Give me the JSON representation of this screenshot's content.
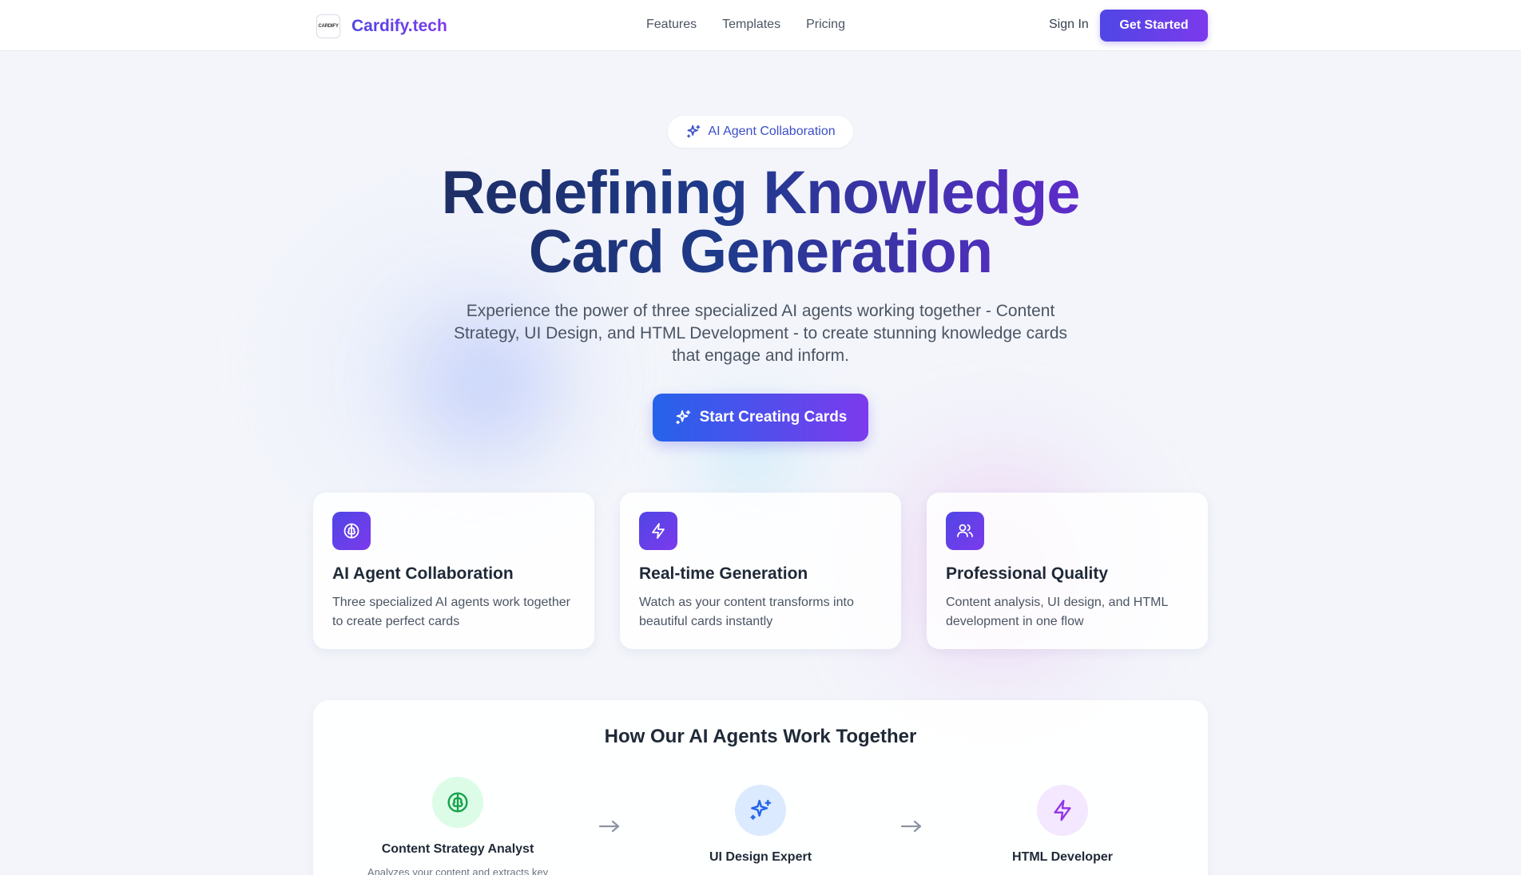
{
  "header": {
    "brand_logo_text": "CARDIFY",
    "brand_name": "Cardify.tech",
    "nav": [
      "Features",
      "Templates",
      "Pricing"
    ],
    "sign_in": "Sign In",
    "get_started": "Get Started"
  },
  "hero": {
    "badge": "AI Agent Collaboration",
    "title_line1": "Redefining Knowledge",
    "title_line2": "Card Generation",
    "subtitle": "Experience the power of three specialized AI agents working together - Content Strategy, UI Design, and HTML Development - to create stunning knowledge cards that engage and inform.",
    "cta": "Start Creating Cards"
  },
  "features": [
    {
      "icon": "brain-icon",
      "title": "AI Agent Collaboration",
      "description": "Three specialized AI agents work together to create perfect cards"
    },
    {
      "icon": "lightning-icon",
      "title": "Real-time Generation",
      "description": "Watch as your content transforms into beautiful cards instantly"
    },
    {
      "icon": "users-icon",
      "title": "Professional Quality",
      "description": "Content analysis, UI design, and HTML development in one flow"
    }
  ],
  "how": {
    "title": "How Our AI Agents Work Together",
    "agents": [
      {
        "icon": "brain-icon",
        "name": "Content Strategy Analyst",
        "description": "Analyzes your content and extracts key"
      },
      {
        "icon": "sparkles-icon",
        "name": "UI Design Expert"
      },
      {
        "icon": "lightning-icon",
        "name": "HTML Developer"
      }
    ]
  },
  "colors": {
    "accent_start": "#4f46e5",
    "accent_end": "#7c3aed",
    "title_dark": "#1e2a5a"
  }
}
